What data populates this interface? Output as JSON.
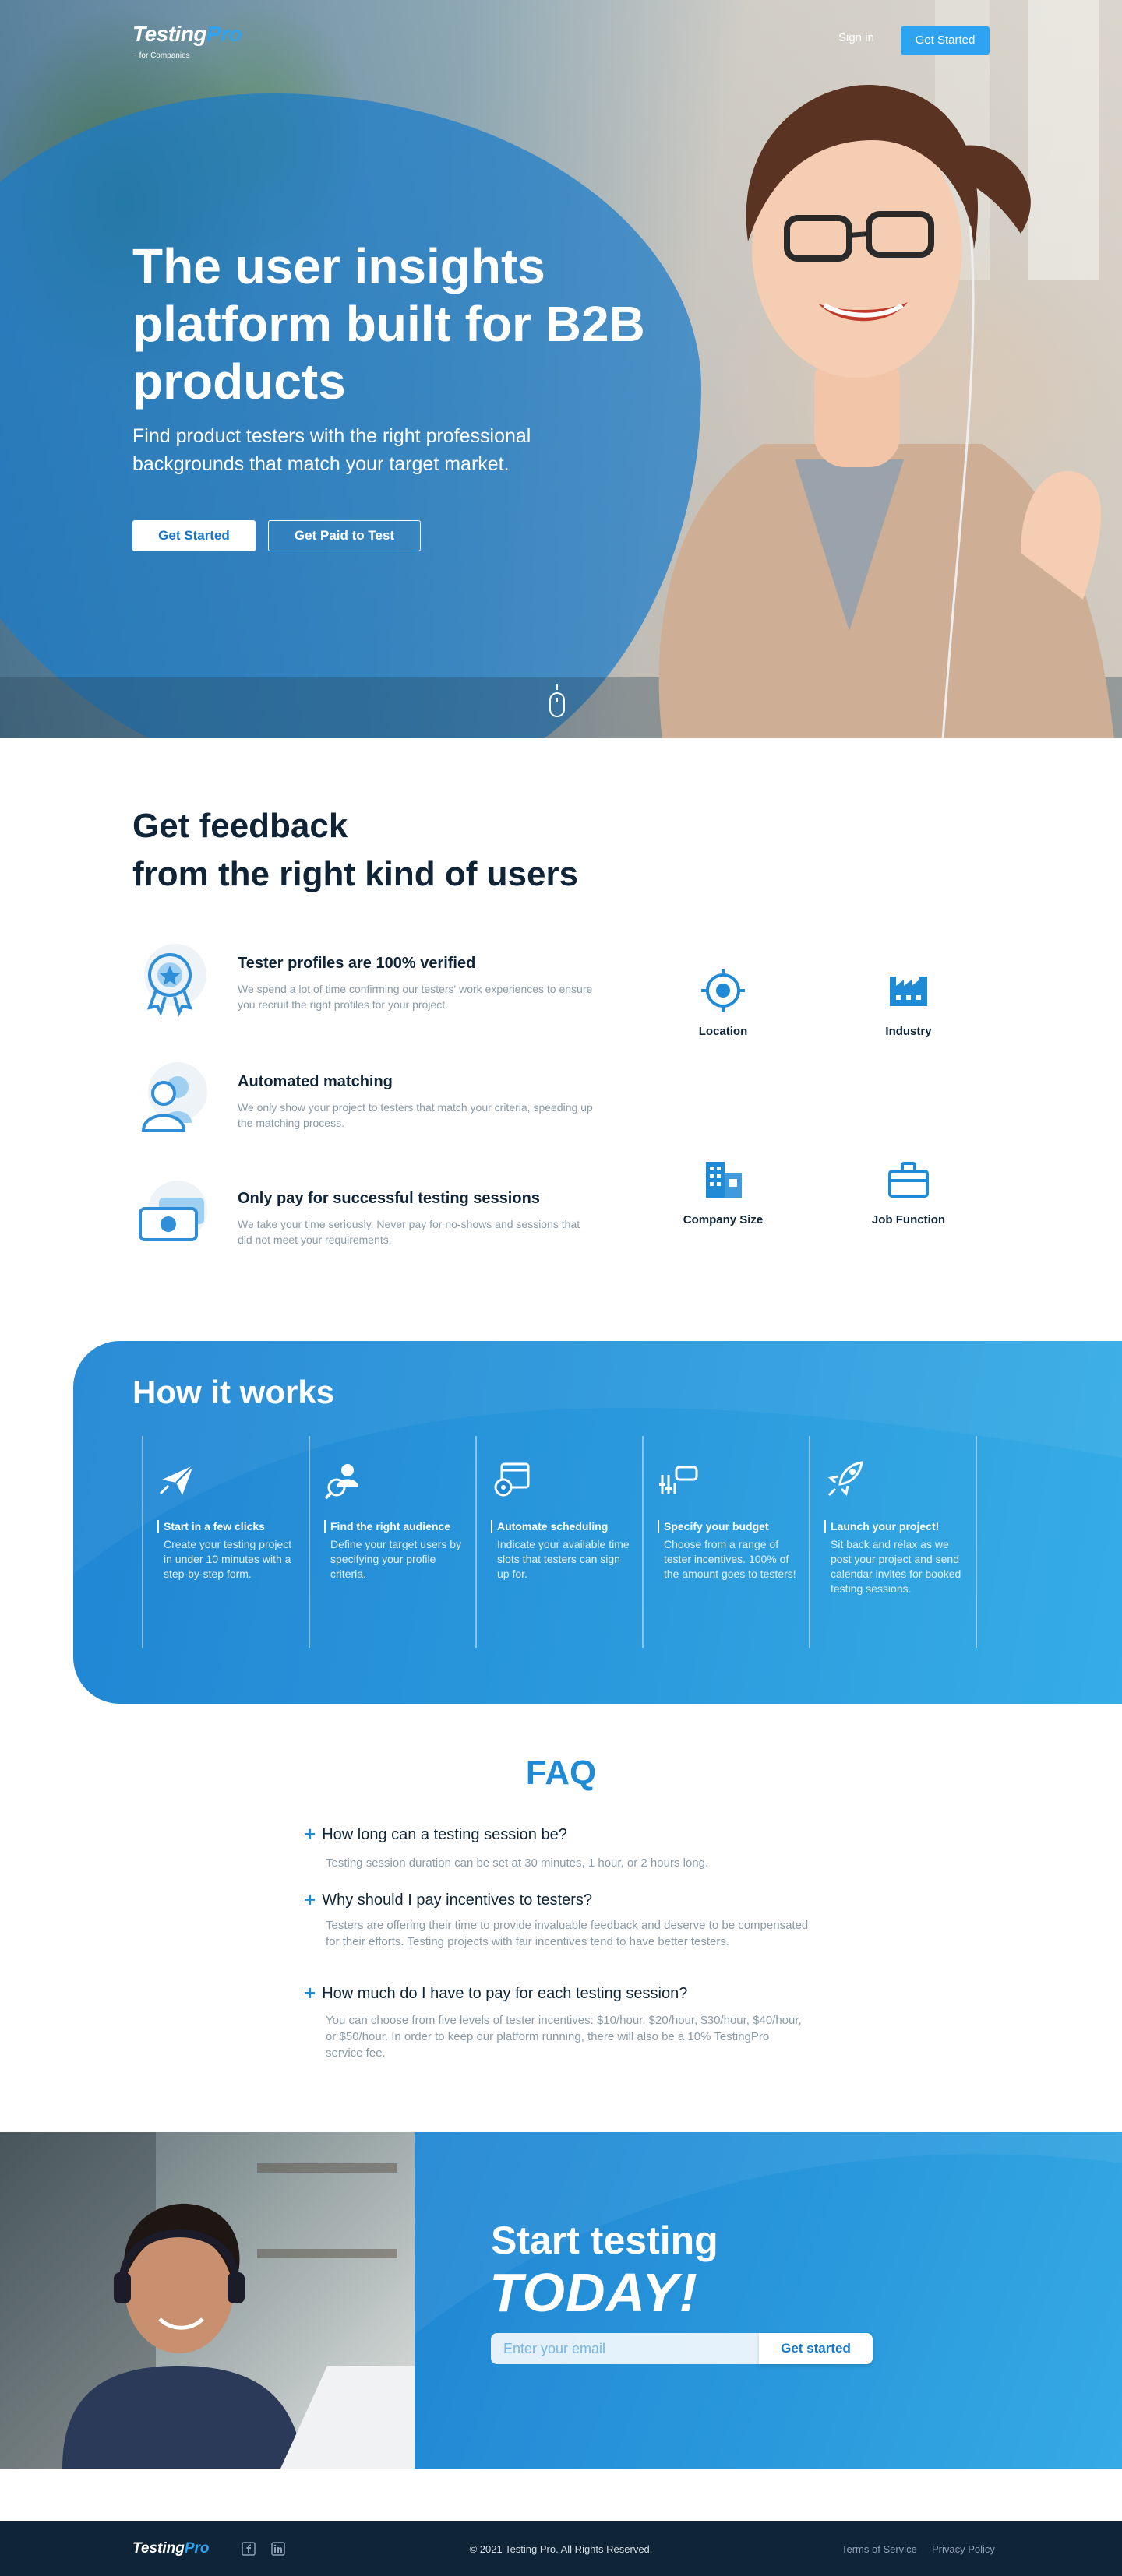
{
  "brand": {
    "logo_main": "Testing",
    "logo_accent": "Pro",
    "logo_sub": "~ for Companies",
    "accent_color": "#2ea3f2",
    "dark_color": "#0f2436"
  },
  "nav": {
    "signin_label": "Sign in",
    "get_started_label": "Get Started"
  },
  "hero": {
    "title": "The user insights platform built for B2B products",
    "subtitle": "Find product testers with the right professional backgrounds that match your target market.",
    "primary_button": "Get Started",
    "secondary_button": "Get Paid to Test",
    "scroll_icon": "mouse-icon"
  },
  "feedback": {
    "title_line1": "Get feedback",
    "title_line2": "from the right kind of users",
    "features": [
      {
        "icon": "verified-badge-icon",
        "title": "Tester profiles are 100% verified",
        "desc": "We spend a lot of time confirming our testers' work experiences to ensure you recruit the right profiles for your project."
      },
      {
        "icon": "user-match-icon",
        "title": "Automated matching",
        "desc": "We only show your project to testers that match your criteria, speeding up the matching process."
      },
      {
        "icon": "money-icon",
        "title": "Only pay for successful testing sessions",
        "desc": "We take your time seriously. Never pay for no-shows and sessions that did not meet your requirements."
      }
    ],
    "criteria": [
      {
        "icon": "location-target-icon",
        "label": "Location"
      },
      {
        "icon": "factory-icon",
        "label": "Industry"
      },
      {
        "icon": "building-icon",
        "label": "Company Size"
      },
      {
        "icon": "briefcase-icon",
        "label": "Job Function"
      }
    ]
  },
  "how": {
    "title": "How it works",
    "steps": [
      {
        "icon": "paper-plane-icon",
        "title": "Start in a few clicks",
        "desc": "Create your testing project in under 10 minutes with a step-by-step form."
      },
      {
        "icon": "search-user-icon",
        "title": "Find the right audience",
        "desc": "Define your target users by specifying your profile criteria."
      },
      {
        "icon": "calendar-gear-icon",
        "title": "Automate scheduling",
        "desc": "Indicate your available time slots that testers can sign up for."
      },
      {
        "icon": "sliders-icon",
        "title": "Specify your budget",
        "desc": "Choose from a range of tester incentives. 100% of the amount goes to testers!"
      },
      {
        "icon": "rocket-icon",
        "title": "Launch your project!",
        "desc": "Sit back and relax as we post your project and send calendar invites for booked testing sessions."
      }
    ]
  },
  "faq": {
    "title": "FAQ",
    "items": [
      {
        "q": "How long can a testing session be?",
        "a": "Testing session duration can be set at 30 minutes, 1 hour, or 2 hours long."
      },
      {
        "q": "Why should I pay incentives to testers?",
        "a": "Testers are offering their time to provide invaluable feedback and deserve to be compensated for their efforts. Testing projects with fair incentives tend to have better testers."
      },
      {
        "q": "How much do I have to pay for each testing session?",
        "a": "You can choose from five levels of tester incentives: $10/hour, $20/hour, $30/hour, $40/hour, or $50/hour. In order to keep our platform running, there will also be a 10% TestingPro service fee."
      }
    ]
  },
  "cta": {
    "title": "Start testing",
    "emphasis": "TODAY!",
    "email_placeholder": "Enter your email",
    "button": "Get started"
  },
  "footer": {
    "logo_main": "Testing",
    "logo_accent": "Pro",
    "social": [
      "facebook-icon",
      "linkedin-icon"
    ],
    "copyright": "© 2021 Testing Pro. All Rights Reserved.",
    "terms": "Terms of Service",
    "privacy": "Privacy Policy"
  }
}
